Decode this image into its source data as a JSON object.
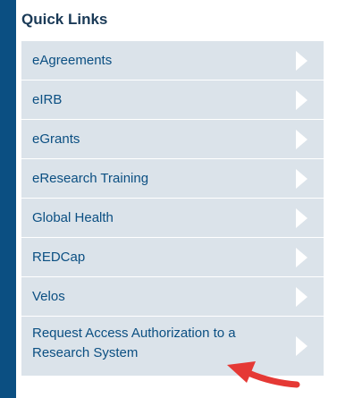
{
  "quick_links": {
    "title": "Quick Links",
    "items": [
      {
        "label": "eAgreements"
      },
      {
        "label": "eIRB"
      },
      {
        "label": "eGrants"
      },
      {
        "label": "eResearch Training"
      },
      {
        "label": "Global Health"
      },
      {
        "label": "REDCap"
      },
      {
        "label": "Velos"
      },
      {
        "label": "Request Access Authorization to a Research System"
      }
    ]
  },
  "icons": {
    "item_chevron": "chevron-right-icon",
    "annotation": "red-arrow-icon"
  },
  "colors": {
    "sidebar": "#0b4f82",
    "item_bg": "#dbe3ea",
    "link_text": "#0b4f82",
    "title_text": "#1a3a57",
    "annotation_arrow": "#e53935"
  }
}
